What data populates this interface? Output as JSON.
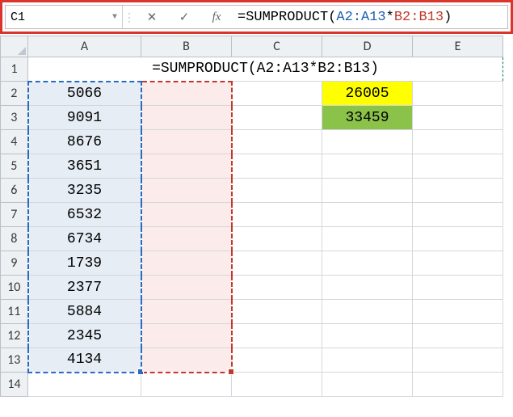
{
  "formula_bar": {
    "cell_ref": "C1",
    "cancel": "✕",
    "confirm": "✓",
    "fx": "fx",
    "formula_prefix": "=SUMPRODUCT(",
    "formula_ref1": "A2:A13",
    "formula_op": "*",
    "formula_ref2": "B2:B13",
    "formula_suffix": ")"
  },
  "columns": [
    "A",
    "B",
    "C",
    "D",
    "E"
  ],
  "row_numbers": [
    "1",
    "2",
    "3",
    "4",
    "5",
    "6",
    "7",
    "8",
    "9",
    "10",
    "11",
    "12",
    "13",
    "14"
  ],
  "merged_row1": "=SUMPRODUCT(A2:A13*B2:B13)",
  "col_a": [
    "5066",
    "9091",
    "8676",
    "3651",
    "3235",
    "6532",
    "6734",
    "1739",
    "2377",
    "5884",
    "2345",
    "4134"
  ],
  "col_d": [
    "26005",
    "33459"
  ],
  "colors": {
    "yellow": "#ffff00",
    "green": "#8ac24a"
  }
}
